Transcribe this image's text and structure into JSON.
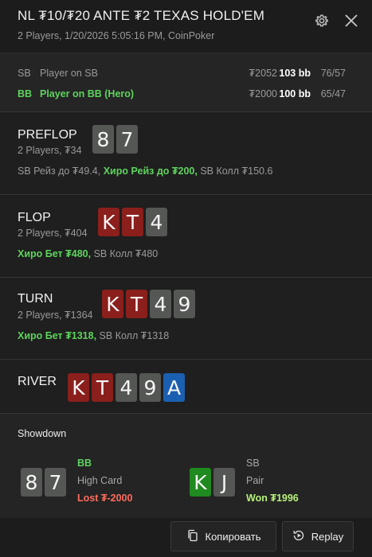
{
  "header": {
    "title": "NL ₮10/₮20 ANTE ₮2 TEXAS HOLD'EM",
    "subtitle": "2 Players, 1/20/2026 5:05:16 PM, CoinPoker"
  },
  "players": [
    {
      "pos": "SB",
      "name": "Player on SB",
      "stack": "₮2052",
      "bb": "103 bb",
      "stats": "76/57"
    },
    {
      "pos": "BB",
      "name": "Player on BB (Hero)",
      "stack": "₮2000",
      "bb": "100 bb",
      "stats": "65/47"
    }
  ],
  "streets": {
    "preflop": {
      "name": "PREFLOP",
      "info": "2 Players, ₮34",
      "cards": [
        "8",
        "7"
      ],
      "actions": {
        "a1": "SB Рейз до ₮49.4,",
        "a2": "Хиро Рейз до ₮200,",
        "a3": "SB Колл ₮150.6"
      }
    },
    "flop": {
      "name": "FLOP",
      "info": "2 Players, ₮404",
      "cards": [
        "K",
        "T",
        "4"
      ],
      "actions": {
        "a1": "Хиро Бет ₮480,",
        "a2": "SB Колл ₮480"
      }
    },
    "turn": {
      "name": "TURN",
      "info": "2 Players, ₮1364",
      "cards": [
        "K",
        "T",
        "4",
        "9"
      ],
      "actions": {
        "a1": "Хиро Бет ₮1318,",
        "a2": "SB Колл ₮1318"
      }
    },
    "river": {
      "name": "RIVER",
      "cards": [
        "K",
        "T",
        "4",
        "9",
        "A"
      ]
    }
  },
  "showdown": {
    "title": "Showdown",
    "hero": {
      "cards": [
        "8",
        "7"
      ],
      "pos": "BB",
      "hand": "High Card",
      "result": "Lost ₮-2000"
    },
    "villain": {
      "cards": [
        "K",
        "J"
      ],
      "pos": "SB",
      "hand": "Pair",
      "result": "Won ₮1996"
    }
  },
  "footer": {
    "copy_label": "Копировать",
    "replay_label": "Replay"
  },
  "colors": {
    "hero_green": "#5fd35f",
    "lost_red": "#ff6b5e",
    "won_green": "#b7f07a",
    "card_grey": "#555755",
    "card_red": "#8a1f1c",
    "card_blue": "#1b5fb0",
    "card_green": "#1f8a1f"
  }
}
